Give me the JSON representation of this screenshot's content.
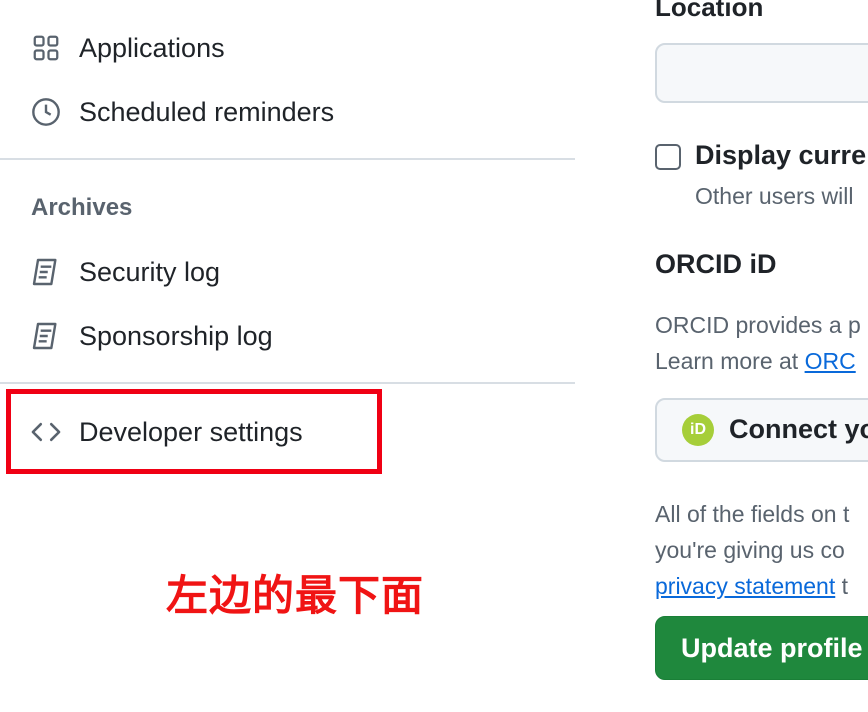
{
  "sidebar": {
    "items": [
      {
        "label": "Applications",
        "icon": "apps-grid-icon"
      },
      {
        "label": "Scheduled reminders",
        "icon": "clock-icon"
      }
    ],
    "archives_header": "Archives",
    "archive_items": [
      {
        "label": "Security log",
        "icon": "log-icon"
      },
      {
        "label": "Sponsorship log",
        "icon": "log-icon"
      }
    ],
    "developer_settings": {
      "label": "Developer settings",
      "icon": "code-icon"
    }
  },
  "annotation": {
    "text": "左边的最下面",
    "color": "#f01414"
  },
  "main": {
    "location_label": "Location",
    "location_value": "",
    "display_checkbox": {
      "label": "Display curre",
      "checked": false,
      "note": "Other users will"
    },
    "orcid": {
      "title": "ORCID iD",
      "desc_line1": "ORCID provides a p",
      "desc_line2_prefix": "Learn more at ",
      "desc_link": "ORC",
      "button_logo": "iD",
      "button_label": "Connect yo"
    },
    "fields_note": {
      "line1": "All of the fields on t",
      "line2": "you're giving us co",
      "link": "privacy statement",
      "suffix": " t"
    },
    "update_button": "Update profile"
  },
  "colors": {
    "accent_link": "#0969da",
    "primary_button": "#1f883d",
    "highlight_border": "#f00014",
    "orcid_green": "#a6ce39"
  }
}
